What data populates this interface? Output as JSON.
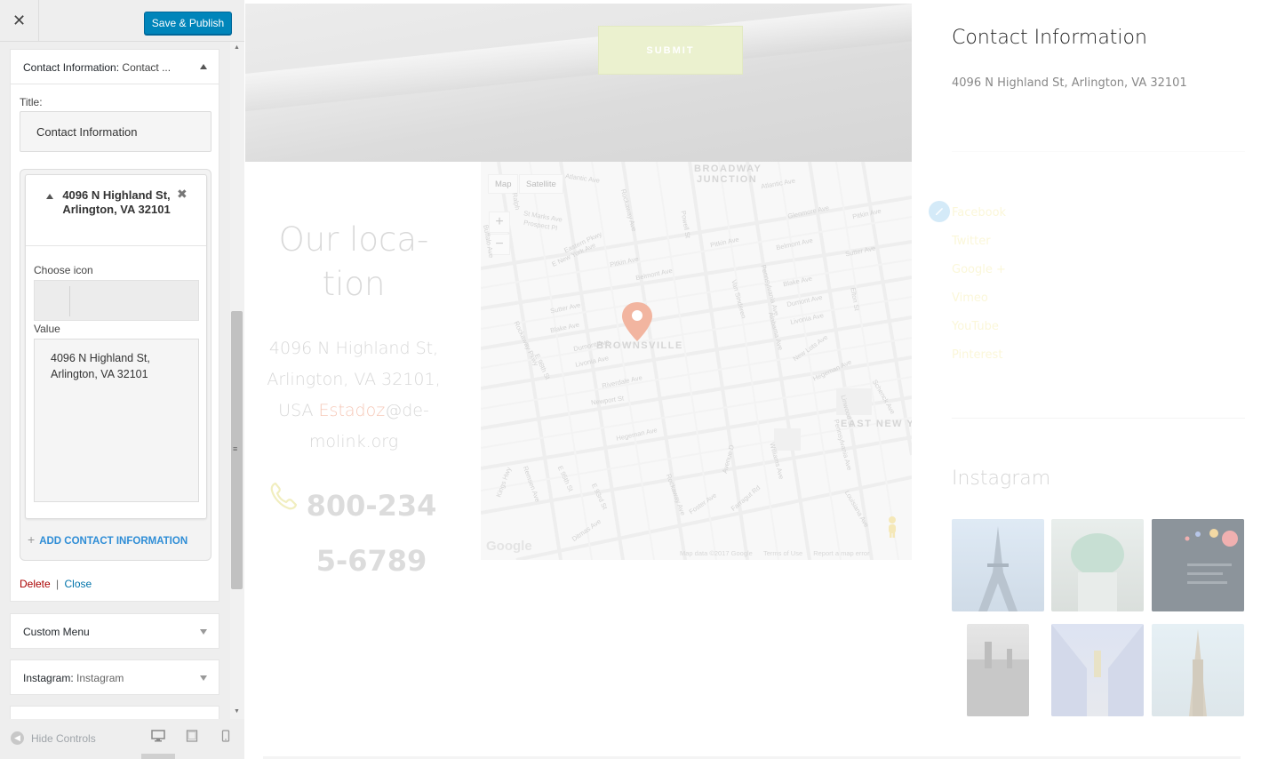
{
  "colors": {
    "publish_bg": "#0085ba",
    "link_blue": "#0073aa",
    "delete_red": "#aa0000",
    "add_blue": "#2e8dd6",
    "accent_peach": "#f6c9b9",
    "submit_green": "#ebf1cf",
    "pin_coral": "#f2b5a0"
  },
  "panel": {
    "close_icon": "close-icon",
    "publish_label": "Save & Publish",
    "widget_contact": {
      "title_prefix": "Contact Information:",
      "title_suffix": "Contact ...",
      "title_label": "Title:",
      "title_value": "Contact Information",
      "item": {
        "heading": "4096 N Highland St, Arlington, VA 32101",
        "choose_icon_label": "Choose icon",
        "value_label": "Value",
        "value": "4096 N Highland St,\nArlington, VA 32101"
      },
      "add_label": "ADD CONTACT INFORMATION",
      "delete_label": "Delete",
      "separator": "|",
      "close_label": "Close"
    },
    "widget_menu": {
      "title": "Custom Menu"
    },
    "widget_instagram": {
      "title_prefix": "Instagram:",
      "title_suffix": "Instagram"
    },
    "footer": {
      "hide_controls": "Hide Controls"
    }
  },
  "preview": {
    "submit_label": "SUBMIT",
    "location": {
      "title_line1": "Our loca-",
      "title_line2": "tion",
      "address_line1": "4096 N Highland St,",
      "address_line2": "Arlington, VA 32101,",
      "address_line3_prefix": "USA",
      "address_line3_accent": "Estadoz",
      "address_line3_suffix": "@de-",
      "address_line4": "molink.org",
      "phone_line1": "800-234",
      "phone_line2": "5-6789"
    },
    "map": {
      "btn_map": "Map",
      "btn_satellite": "Satellite",
      "zoom_in": "+",
      "zoom_out": "−",
      "areas": {
        "broadway": "BROADWAY",
        "junction": "JUNCTION",
        "brownsville": "BROWNSVILLE",
        "east_new_york": "EAST NEW Y"
      },
      "streets": {
        "atlantic": "Atlantic Ave",
        "atlantic2": "Atlantic Ave",
        "st_marks": "St Marks Ave",
        "prospect": "Prospect Pl",
        "eastern": "Eastern Pkwy",
        "east_ny": "E New York Ave",
        "pitkin1": "Pitkin Ave",
        "pitkin2": "Pitkin Ave",
        "pitkin3": "Pitkin Ave",
        "belmont1": "Belmont Ave",
        "belmont2": "Belmont Ave",
        "sutter1": "Sutter Ave",
        "sutter2": "Sutter Ave",
        "blake1": "Blake Ave",
        "blake2": "Blake Ave",
        "dumont1": "Dumont Ave",
        "dumont2": "Dumont Ave",
        "livonia1": "Livonia Ave",
        "livonia2": "Livonia Ave",
        "riverdale": "Riverdale Ave",
        "newport": "Newport St",
        "new_lots": "New Lots Ave",
        "hegeman1": "Hegeman Ave",
        "hegeman2": "Hegeman Ave",
        "glenmore": "Glenmore Ave",
        "foster": "Foster Ave",
        "farragut": "Farragut Rd",
        "ditmas": "Ditmas Ave",
        "rockaway_ave": "Rockaway Ave",
        "rockaway_pkwy": "Rockaway Pkwy",
        "ralph": "Ralph",
        "buffalo": "Buffalo Ave",
        "powell": "Powell St",
        "pennsylvania1": "Pennsylvania Ave",
        "pennsylvania2": "Pennsylvania Ave",
        "williams": "Williams Ave",
        "alabama": "Alabama Ave",
        "van_sinderen": "Van Sinderen",
        "avenue_d": "Avenue D",
        "schenck": "Schenck Ave",
        "e98": "E 98th St",
        "e95": "E 95th St",
        "e93": "E 93rd St",
        "kings_hwy": "Kings Hwy",
        "remsen": "Remsen Ave",
        "linwood": "Linwood St",
        "louisiana": "Louisiana Ave",
        "elton": "Elton St",
        "rockaway_ave2": "Rockaway Ave"
      },
      "google_logo": "Google",
      "map_data": "Map data ©2017 Google",
      "terms": "Terms of Use",
      "report": "Report a map error"
    },
    "sidebar": {
      "contact_title": "Contact Information",
      "contact_address": "4096 N Highland St, Arlington, VA 32101",
      "social": [
        "Facebook",
        "Twitter",
        "Google +",
        "Vimeo",
        "YouTube",
        "Pinterest"
      ],
      "instagram_title": "Instagram"
    }
  }
}
